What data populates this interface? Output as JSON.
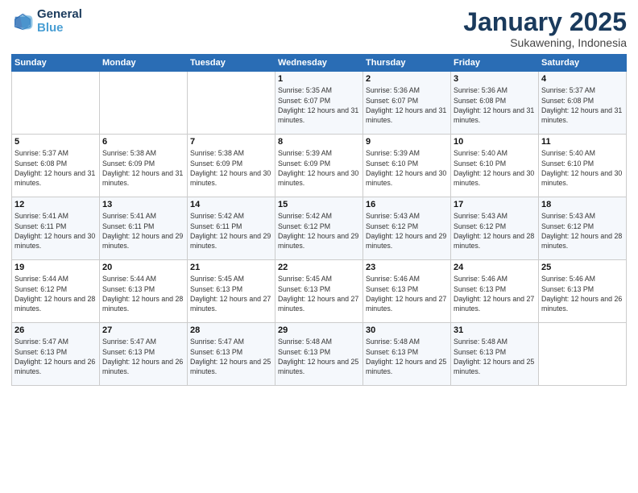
{
  "logo": {
    "text_general": "General",
    "text_blue": "Blue"
  },
  "header": {
    "month": "January 2025",
    "location": "Sukawening, Indonesia"
  },
  "weekdays": [
    "Sunday",
    "Monday",
    "Tuesday",
    "Wednesday",
    "Thursday",
    "Friday",
    "Saturday"
  ],
  "weeks": [
    [
      {
        "day": "",
        "sunrise": "",
        "sunset": "",
        "daylight": ""
      },
      {
        "day": "",
        "sunrise": "",
        "sunset": "",
        "daylight": ""
      },
      {
        "day": "",
        "sunrise": "",
        "sunset": "",
        "daylight": ""
      },
      {
        "day": "1",
        "sunrise": "Sunrise: 5:35 AM",
        "sunset": "Sunset: 6:07 PM",
        "daylight": "Daylight: 12 hours and 31 minutes."
      },
      {
        "day": "2",
        "sunrise": "Sunrise: 5:36 AM",
        "sunset": "Sunset: 6:07 PM",
        "daylight": "Daylight: 12 hours and 31 minutes."
      },
      {
        "day": "3",
        "sunrise": "Sunrise: 5:36 AM",
        "sunset": "Sunset: 6:08 PM",
        "daylight": "Daylight: 12 hours and 31 minutes."
      },
      {
        "day": "4",
        "sunrise": "Sunrise: 5:37 AM",
        "sunset": "Sunset: 6:08 PM",
        "daylight": "Daylight: 12 hours and 31 minutes."
      }
    ],
    [
      {
        "day": "5",
        "sunrise": "Sunrise: 5:37 AM",
        "sunset": "Sunset: 6:08 PM",
        "daylight": "Daylight: 12 hours and 31 minutes."
      },
      {
        "day": "6",
        "sunrise": "Sunrise: 5:38 AM",
        "sunset": "Sunset: 6:09 PM",
        "daylight": "Daylight: 12 hours and 31 minutes."
      },
      {
        "day": "7",
        "sunrise": "Sunrise: 5:38 AM",
        "sunset": "Sunset: 6:09 PM",
        "daylight": "Daylight: 12 hours and 30 minutes."
      },
      {
        "day": "8",
        "sunrise": "Sunrise: 5:39 AM",
        "sunset": "Sunset: 6:09 PM",
        "daylight": "Daylight: 12 hours and 30 minutes."
      },
      {
        "day": "9",
        "sunrise": "Sunrise: 5:39 AM",
        "sunset": "Sunset: 6:10 PM",
        "daylight": "Daylight: 12 hours and 30 minutes."
      },
      {
        "day": "10",
        "sunrise": "Sunrise: 5:40 AM",
        "sunset": "Sunset: 6:10 PM",
        "daylight": "Daylight: 12 hours and 30 minutes."
      },
      {
        "day": "11",
        "sunrise": "Sunrise: 5:40 AM",
        "sunset": "Sunset: 6:10 PM",
        "daylight": "Daylight: 12 hours and 30 minutes."
      }
    ],
    [
      {
        "day": "12",
        "sunrise": "Sunrise: 5:41 AM",
        "sunset": "Sunset: 6:11 PM",
        "daylight": "Daylight: 12 hours and 30 minutes."
      },
      {
        "day": "13",
        "sunrise": "Sunrise: 5:41 AM",
        "sunset": "Sunset: 6:11 PM",
        "daylight": "Daylight: 12 hours and 29 minutes."
      },
      {
        "day": "14",
        "sunrise": "Sunrise: 5:42 AM",
        "sunset": "Sunset: 6:11 PM",
        "daylight": "Daylight: 12 hours and 29 minutes."
      },
      {
        "day": "15",
        "sunrise": "Sunrise: 5:42 AM",
        "sunset": "Sunset: 6:12 PM",
        "daylight": "Daylight: 12 hours and 29 minutes."
      },
      {
        "day": "16",
        "sunrise": "Sunrise: 5:43 AM",
        "sunset": "Sunset: 6:12 PM",
        "daylight": "Daylight: 12 hours and 29 minutes."
      },
      {
        "day": "17",
        "sunrise": "Sunrise: 5:43 AM",
        "sunset": "Sunset: 6:12 PM",
        "daylight": "Daylight: 12 hours and 28 minutes."
      },
      {
        "day": "18",
        "sunrise": "Sunrise: 5:43 AM",
        "sunset": "Sunset: 6:12 PM",
        "daylight": "Daylight: 12 hours and 28 minutes."
      }
    ],
    [
      {
        "day": "19",
        "sunrise": "Sunrise: 5:44 AM",
        "sunset": "Sunset: 6:12 PM",
        "daylight": "Daylight: 12 hours and 28 minutes."
      },
      {
        "day": "20",
        "sunrise": "Sunrise: 5:44 AM",
        "sunset": "Sunset: 6:13 PM",
        "daylight": "Daylight: 12 hours and 28 minutes."
      },
      {
        "day": "21",
        "sunrise": "Sunrise: 5:45 AM",
        "sunset": "Sunset: 6:13 PM",
        "daylight": "Daylight: 12 hours and 27 minutes."
      },
      {
        "day": "22",
        "sunrise": "Sunrise: 5:45 AM",
        "sunset": "Sunset: 6:13 PM",
        "daylight": "Daylight: 12 hours and 27 minutes."
      },
      {
        "day": "23",
        "sunrise": "Sunrise: 5:46 AM",
        "sunset": "Sunset: 6:13 PM",
        "daylight": "Daylight: 12 hours and 27 minutes."
      },
      {
        "day": "24",
        "sunrise": "Sunrise: 5:46 AM",
        "sunset": "Sunset: 6:13 PM",
        "daylight": "Daylight: 12 hours and 27 minutes."
      },
      {
        "day": "25",
        "sunrise": "Sunrise: 5:46 AM",
        "sunset": "Sunset: 6:13 PM",
        "daylight": "Daylight: 12 hours and 26 minutes."
      }
    ],
    [
      {
        "day": "26",
        "sunrise": "Sunrise: 5:47 AM",
        "sunset": "Sunset: 6:13 PM",
        "daylight": "Daylight: 12 hours and 26 minutes."
      },
      {
        "day": "27",
        "sunrise": "Sunrise: 5:47 AM",
        "sunset": "Sunset: 6:13 PM",
        "daylight": "Daylight: 12 hours and 26 minutes."
      },
      {
        "day": "28",
        "sunrise": "Sunrise: 5:47 AM",
        "sunset": "Sunset: 6:13 PM",
        "daylight": "Daylight: 12 hours and 25 minutes."
      },
      {
        "day": "29",
        "sunrise": "Sunrise: 5:48 AM",
        "sunset": "Sunset: 6:13 PM",
        "daylight": "Daylight: 12 hours and 25 minutes."
      },
      {
        "day": "30",
        "sunrise": "Sunrise: 5:48 AM",
        "sunset": "Sunset: 6:13 PM",
        "daylight": "Daylight: 12 hours and 25 minutes."
      },
      {
        "day": "31",
        "sunrise": "Sunrise: 5:48 AM",
        "sunset": "Sunset: 6:13 PM",
        "daylight": "Daylight: 12 hours and 25 minutes."
      },
      {
        "day": "",
        "sunrise": "",
        "sunset": "",
        "daylight": ""
      }
    ]
  ]
}
